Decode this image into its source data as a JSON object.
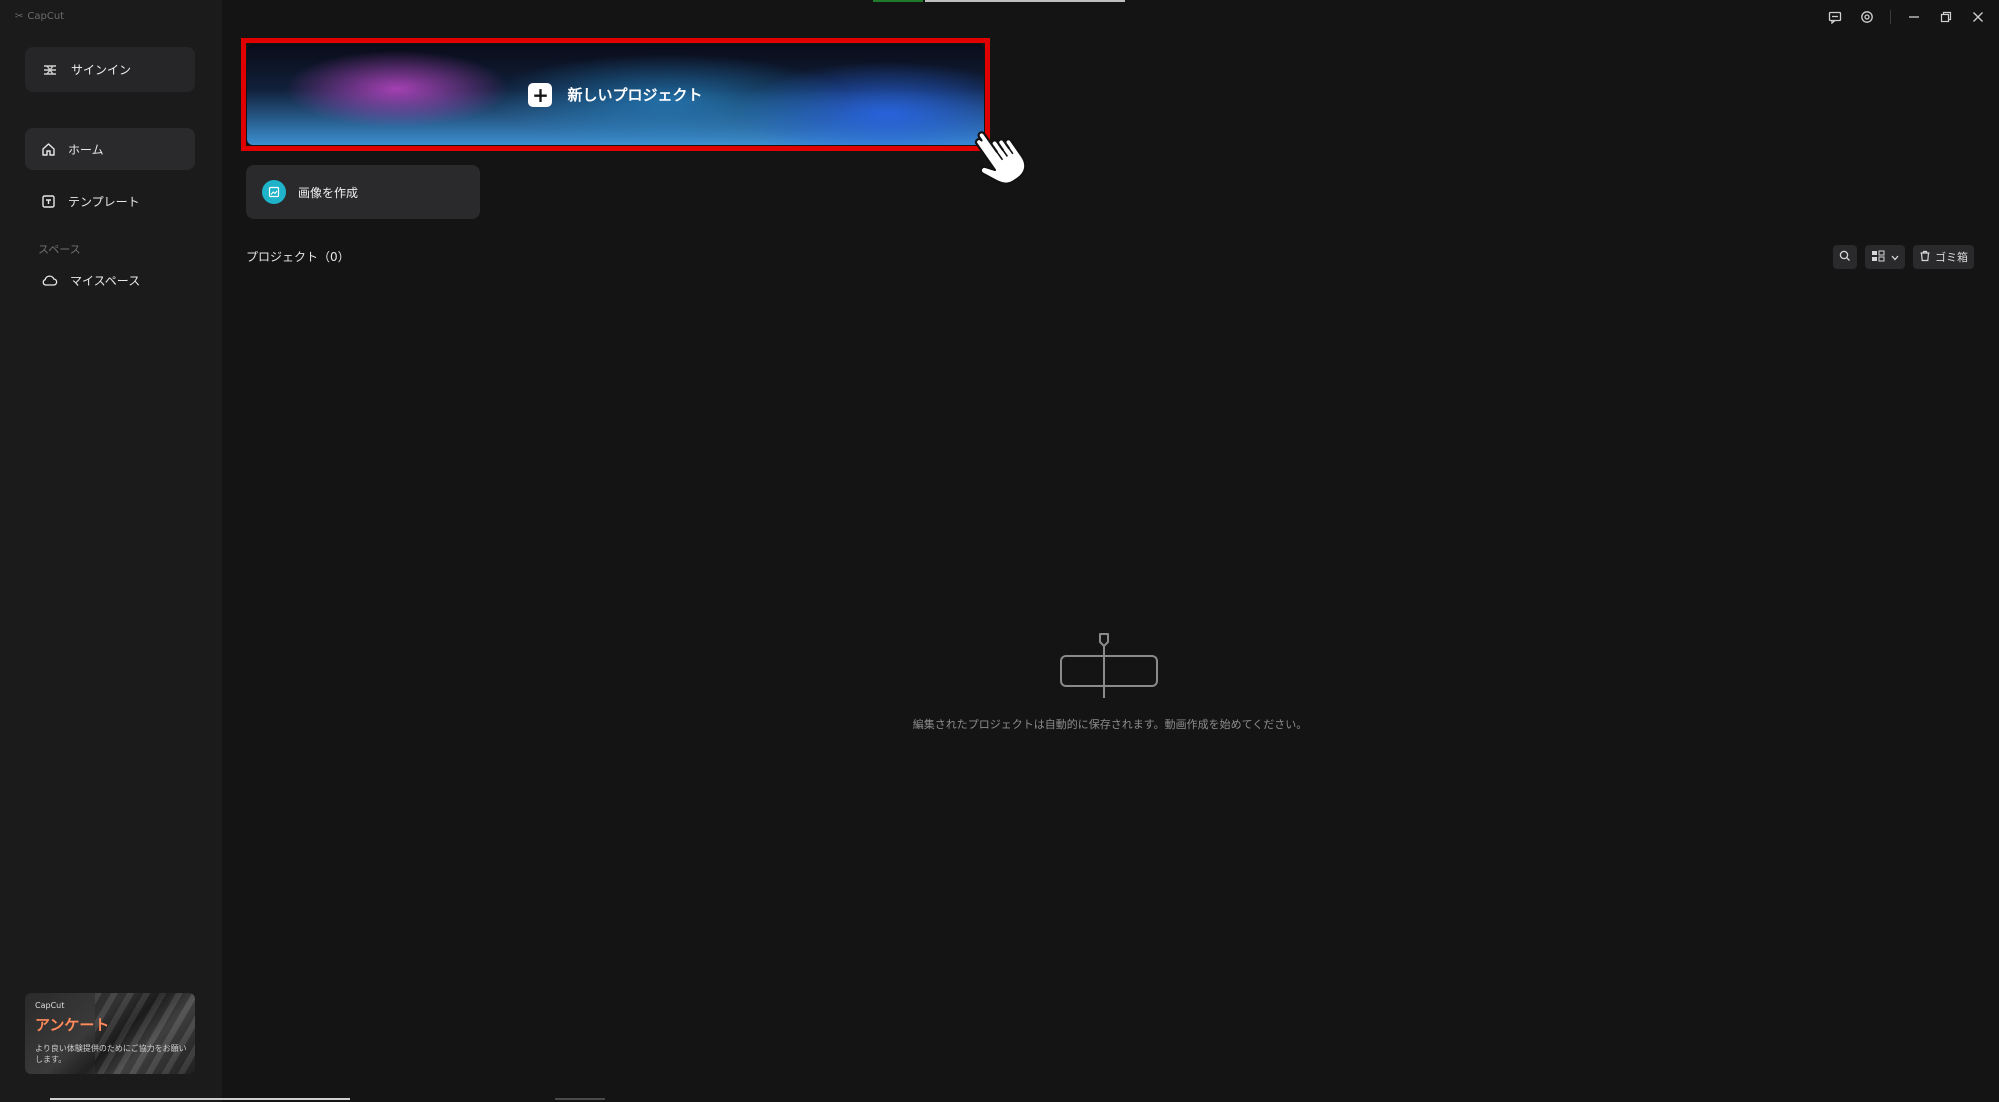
{
  "app": {
    "name": "CapCut"
  },
  "sidebar": {
    "sign_in_label": "サインイン",
    "nav": [
      {
        "label": "ホーム",
        "icon": "home-icon",
        "active": true
      },
      {
        "label": "テンプレート",
        "icon": "template-icon",
        "active": false
      }
    ],
    "section_label": "スペース",
    "space_item": {
      "label": "マイスペース",
      "icon": "cloud-icon"
    },
    "survey": {
      "brand": "CapCut",
      "title": "アンケート",
      "description": "より良い体験提供のためにご協力をお願いします。"
    }
  },
  "main": {
    "new_project_label": "新しいプロジェクト",
    "create_image_label": "画像を作成",
    "projects_heading": "プロジェクト（0）",
    "trash_label": "ゴミ箱",
    "empty_message": "編集されたプロジェクトは自動的に保存されます。動画作成を始めてください。"
  },
  "colors": {
    "highlight_border": "#e00000",
    "accent_teal": "#1fb3c9",
    "survey_title": "#ff8a5b"
  }
}
